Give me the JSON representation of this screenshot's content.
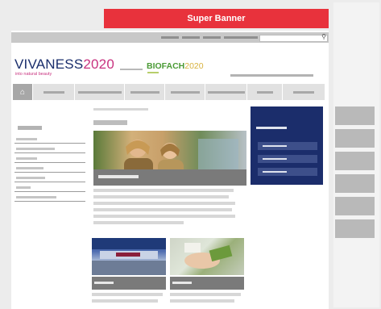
{
  "super_banner": {
    "label": "Super Banner",
    "color": "#e8323c"
  },
  "logos": {
    "vivaness_word": "VIVANESS",
    "vivaness_year": "2020",
    "vivaness_tagline": "into natural beauty",
    "biofach_word": "BIOFACH",
    "biofach_year": "2020"
  },
  "colors": {
    "brand_blue": "#1b2d6b",
    "vivaness_pink": "#c8327f",
    "biofach_green": "#4b9b36",
    "placeholder_grey": "#b3b3b3"
  },
  "icons": {
    "home": "home-icon",
    "search": "search-icon"
  }
}
